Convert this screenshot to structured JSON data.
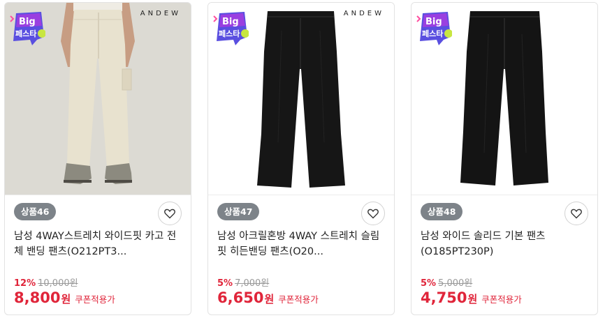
{
  "badge": {
    "line1": "Big",
    "line2": "페스타"
  },
  "products": [
    {
      "brand": "ANDEW",
      "rank": "상품46",
      "title": "남성 4WAY스트레치 와이드핏 카고 전체 밴딩 팬츠(O212PT3...",
      "discount": "12%",
      "original_price": "10,000원",
      "price": "8,800",
      "price_unit": "원",
      "coupon_label": "쿠폰적용가",
      "pants_color": "#e6e0cd"
    },
    {
      "brand": "ANDEW",
      "rank": "상품47",
      "title": "남성 아크릴혼방 4WAY 스트레치 슬림핏 히든밴딩 팬츠(O20...",
      "discount": "5%",
      "original_price": "7,000원",
      "price": "6,650",
      "price_unit": "원",
      "coupon_label": "쿠폰적용가",
      "pants_color": "#161616"
    },
    {
      "brand": "",
      "rank": "상품48",
      "title": "남성 와이드 솔리드 기본 팬츠(O185PT230P)",
      "discount": "5%",
      "original_price": "5,000원",
      "price": "4,750",
      "price_unit": "원",
      "coupon_label": "쿠폰적용가",
      "pants_color": "#141414"
    }
  ],
  "colors": {
    "accent_red": "#e0253a",
    "rank_pill": "#7d8389"
  }
}
